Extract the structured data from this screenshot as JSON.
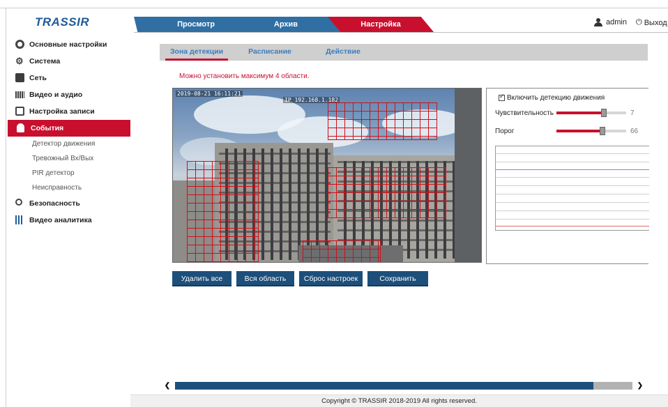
{
  "header": {
    "logo": "TRASSIR",
    "tabs": [
      "Просмотр",
      "Архив",
      "Настройка"
    ],
    "active_tab": "Настройка",
    "user": "admin",
    "logout": "Выход"
  },
  "sidebar": {
    "items": [
      {
        "label": "Основные настройки",
        "icon": "gear-icon"
      },
      {
        "label": "Система",
        "icon": "gears-icon"
      },
      {
        "label": "Сеть",
        "icon": "network-icon"
      },
      {
        "label": "Видео и аудио",
        "icon": "video-icon"
      },
      {
        "label": "Настройка записи",
        "icon": "disk-icon"
      },
      {
        "label": "События",
        "icon": "event-icon",
        "active": true
      },
      {
        "label": "Безопасность",
        "icon": "security-icon"
      },
      {
        "label": "Видео аналитика",
        "icon": "analytics-icon"
      }
    ],
    "sub_items": [
      "Детектор движения",
      "Тревожный Вх/Вых",
      "PIR детектор",
      "Неисправность"
    ]
  },
  "subtabs": [
    "Зона детекции",
    "Расписание",
    "Действие"
  ],
  "warning": "Можно установить максимум 4 области.",
  "video": {
    "osd_time": "2019-08-21 16:11:21",
    "osd_label": "IP 192.168.1.182"
  },
  "buttons": {
    "delete_all": "Удалить все",
    "whole_area": "Вся область",
    "reset": "Сброс настроек",
    "save": "Сохранить"
  },
  "panel": {
    "enable_label": "Включить детекцию движения",
    "enabled": true,
    "sensitivity_label": "Чувствительность",
    "sensitivity_value": "7",
    "sensitivity_fraction": 0.68,
    "threshold_label": "Порог",
    "threshold_value": "66",
    "threshold_fraction": 0.66
  },
  "colors": {
    "accent_red": "#c8102e",
    "brand_blue": "#2f6fa4",
    "button_blue": "#1d4f7a"
  },
  "footer": "Copyright © TRASSIR 2018-2019 All rights reserved."
}
